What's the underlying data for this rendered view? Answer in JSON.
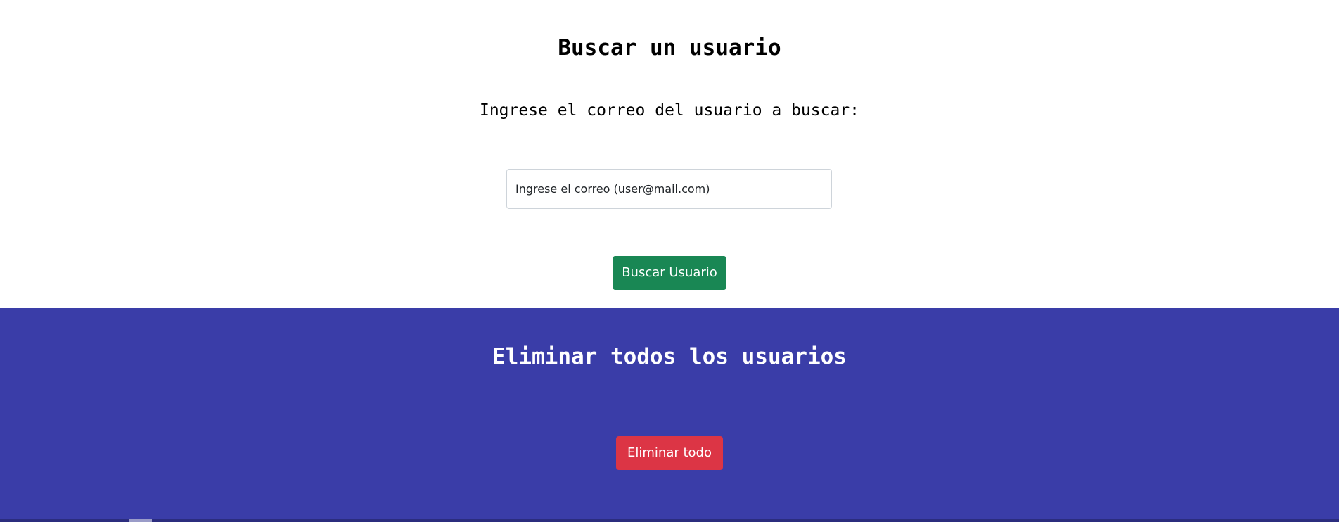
{
  "search": {
    "title": "Buscar un usuario",
    "label": "Ingrese el correo del usuario a buscar:",
    "input_value": "",
    "input_placeholder": "Ingrese el correo (user@mail.com)",
    "button_label": "Buscar Usuario"
  },
  "delete_all": {
    "title": "Eliminar todos los usuarios",
    "button_label": "Eliminar todo"
  },
  "colors": {
    "search_background": "#ffffff",
    "delete_background": "#3a3da8",
    "search_button": "#198754",
    "delete_button": "#dc3545"
  }
}
